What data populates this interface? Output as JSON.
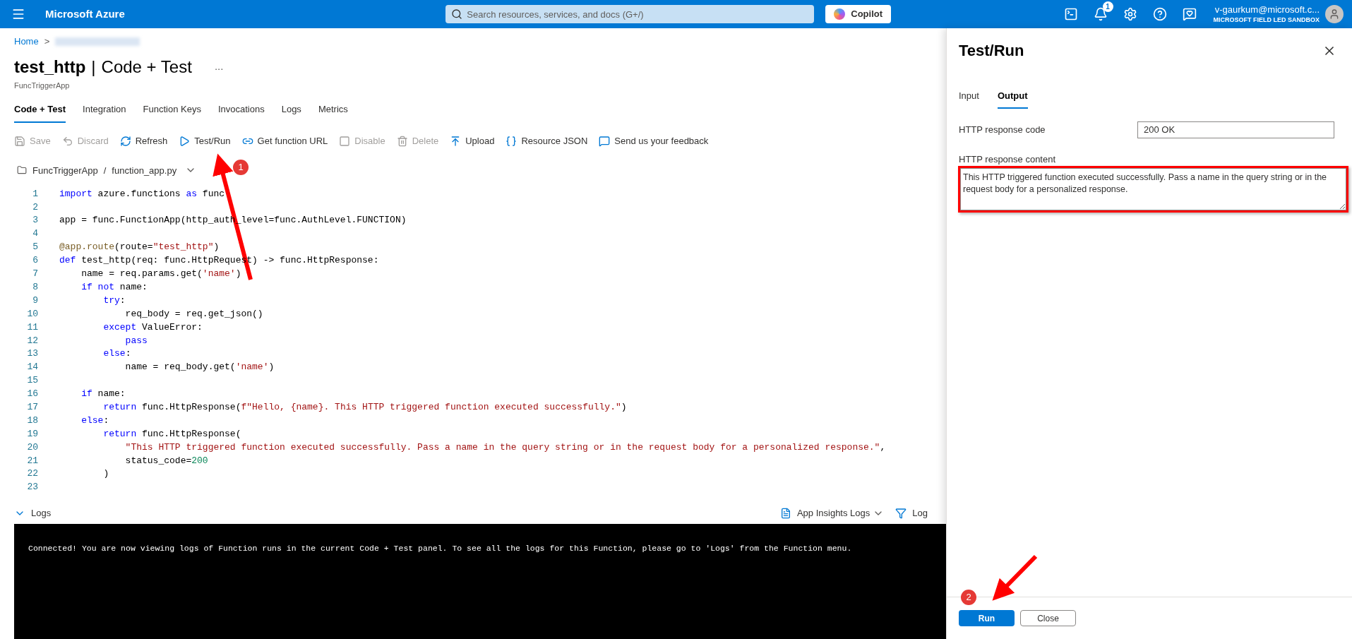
{
  "topbar": {
    "brand": "Microsoft Azure",
    "search": {
      "placeholder": "Search resources, services, and docs (G+/)"
    },
    "copilot": "Copilot",
    "notification_count": "1",
    "user": {
      "email": "v-gaurkum@microsoft.c...",
      "tenant": "MICROSOFT FIELD LED SANDBOX"
    }
  },
  "breadcrumb": {
    "home": "Home",
    "separator": ">"
  },
  "header": {
    "title": "test_http",
    "separator": "|",
    "subtitle": "Code + Test",
    "more": "...",
    "app": "FuncTriggerApp"
  },
  "tabs": [
    {
      "label": "Code + Test",
      "selected": true
    },
    {
      "label": "Integration",
      "selected": false
    },
    {
      "label": "Function Keys",
      "selected": false
    },
    {
      "label": "Invocations",
      "selected": false
    },
    {
      "label": "Logs",
      "selected": false
    },
    {
      "label": "Metrics",
      "selected": false
    }
  ],
  "toolbar": [
    {
      "label": "Save",
      "disabled": true
    },
    {
      "label": "Discard",
      "disabled": true
    },
    {
      "label": "Refresh",
      "disabled": false
    },
    {
      "label": "Test/Run",
      "disabled": false
    },
    {
      "label": "Get function URL",
      "disabled": false
    },
    {
      "label": "Disable",
      "disabled": true
    },
    {
      "label": "Delete",
      "disabled": true
    },
    {
      "label": "Upload",
      "disabled": false
    },
    {
      "label": "Resource JSON",
      "disabled": false
    },
    {
      "label": "Send us your feedback",
      "disabled": false
    }
  ],
  "file_path": {
    "folder": "FuncTriggerApp",
    "separator": "/",
    "file": "function_app.py"
  },
  "code": [
    {
      "number": "1",
      "tokens": [
        {
          "kind": "keyword",
          "text": "import"
        },
        {
          "kind": "plain",
          "text": " azure.functions "
        },
        {
          "kind": "keyword",
          "text": "as"
        },
        {
          "kind": "plain",
          "text": " func"
        }
      ]
    },
    {
      "number": "2"
    },
    {
      "number": "3",
      "tokens": [
        {
          "kind": "plain",
          "text": "app = func.FunctionApp(http_auth_level=func.AuthLevel.FUNCTION)"
        }
      ]
    },
    {
      "number": "4"
    },
    {
      "number": "5",
      "tokens": [
        {
          "kind": "decorator",
          "text": "@app.route"
        },
        {
          "kind": "plain",
          "text": "(route="
        },
        {
          "kind": "string",
          "text": "\"test_http\""
        },
        {
          "kind": "plain",
          "text": ")"
        }
      ]
    },
    {
      "number": "6",
      "tokens": [
        {
          "kind": "keyword",
          "text": "def"
        },
        {
          "kind": "plain",
          "text": " test_http(req: func.HttpRequest) -> func.HttpResponse:"
        }
      ]
    },
    {
      "number": "7",
      "tokens": [
        {
          "kind": "plain",
          "text": "    name = req.params.get("
        },
        {
          "kind": "string",
          "text": "'name'"
        },
        {
          "kind": "plain",
          "text": ")"
        }
      ]
    },
    {
      "number": "8",
      "tokens": [
        {
          "kind": "keyword",
          "text": "    if"
        },
        {
          "kind": "keyword",
          "text": " not"
        },
        {
          "kind": "plain",
          "text": " name:"
        }
      ]
    },
    {
      "number": "9",
      "tokens": [
        {
          "kind": "keyword",
          "text": "        try"
        },
        {
          "kind": "plain",
          "text": ":"
        }
      ]
    },
    {
      "number": "10",
      "tokens": [
        {
          "kind": "plain",
          "text": "            req_body = req.get_json()"
        }
      ]
    },
    {
      "number": "11",
      "tokens": [
        {
          "kind": "keyword",
          "text": "        except"
        },
        {
          "kind": "plain",
          "text": " ValueError:"
        }
      ]
    },
    {
      "number": "12",
      "tokens": [
        {
          "kind": "keyword",
          "text": "            pass"
        }
      ]
    },
    {
      "number": "13",
      "tokens": [
        {
          "kind": "keyword",
          "text": "        else"
        },
        {
          "kind": "plain",
          "text": ":"
        }
      ]
    },
    {
      "number": "14",
      "tokens": [
        {
          "kind": "plain",
          "text": "            name = req_body.get("
        },
        {
          "kind": "string",
          "text": "'name'"
        },
        {
          "kind": "plain",
          "text": ")"
        }
      ]
    },
    {
      "number": "15"
    },
    {
      "number": "16",
      "tokens": [
        {
          "kind": "keyword",
          "text": "    if"
        },
        {
          "kind": "plain",
          "text": " name:"
        }
      ]
    },
    {
      "number": "17",
      "tokens": [
        {
          "kind": "keyword",
          "text": "        return"
        },
        {
          "kind": "plain",
          "text": " func.HttpResponse("
        },
        {
          "kind": "string",
          "text": "f\"Hello, {name}. This HTTP triggered function executed successfully.\""
        },
        {
          "kind": "plain",
          "text": ")"
        }
      ]
    },
    {
      "number": "18",
      "tokens": [
        {
          "kind": "keyword",
          "text": "    else"
        },
        {
          "kind": "plain",
          "text": ":"
        }
      ]
    },
    {
      "number": "19",
      "tokens": [
        {
          "kind": "keyword",
          "text": "        return"
        },
        {
          "kind": "plain",
          "text": " func.HttpResponse("
        }
      ]
    },
    {
      "number": "20",
      "tokens": [
        {
          "kind": "string",
          "text": "            \"This HTTP triggered function executed successfully. Pass a name in the query string or in the request body for a personalized response.\""
        },
        {
          "kind": "plain",
          "text": ","
        }
      ]
    },
    {
      "number": "21",
      "tokens": [
        {
          "kind": "plain",
          "text": "            status_code="
        },
        {
          "kind": "number",
          "text": "200"
        }
      ]
    },
    {
      "number": "22",
      "tokens": [
        {
          "kind": "plain",
          "text": "        )"
        }
      ]
    },
    {
      "number": "23"
    }
  ],
  "logs": {
    "label": "Logs",
    "expanded": true,
    "insights": "App Insights Logs",
    "filter": "Log",
    "message": "Connected! You are now viewing logs of Function runs in the current Code + Test panel. To see all the logs for this Function, please go to 'Logs' from the Function menu."
  },
  "panel": {
    "title": "Test/Run",
    "tabs": [
      {
        "label": "Input",
        "selected": false
      },
      {
        "label": "Output",
        "selected": true
      }
    ],
    "response_code_label": "HTTP response code",
    "response_code": "200 OK",
    "response_content_label": "HTTP response content",
    "response_content": "This HTTP triggered function executed successfully. Pass a name in the query string or in the request body for a personalized response.",
    "buttons": [
      {
        "label": "Run",
        "kind": "primary"
      },
      {
        "label": "Close",
        "kind": "secondary"
      }
    ]
  },
  "annotations": [
    {
      "label": "1"
    },
    {
      "label": "2"
    }
  ]
}
